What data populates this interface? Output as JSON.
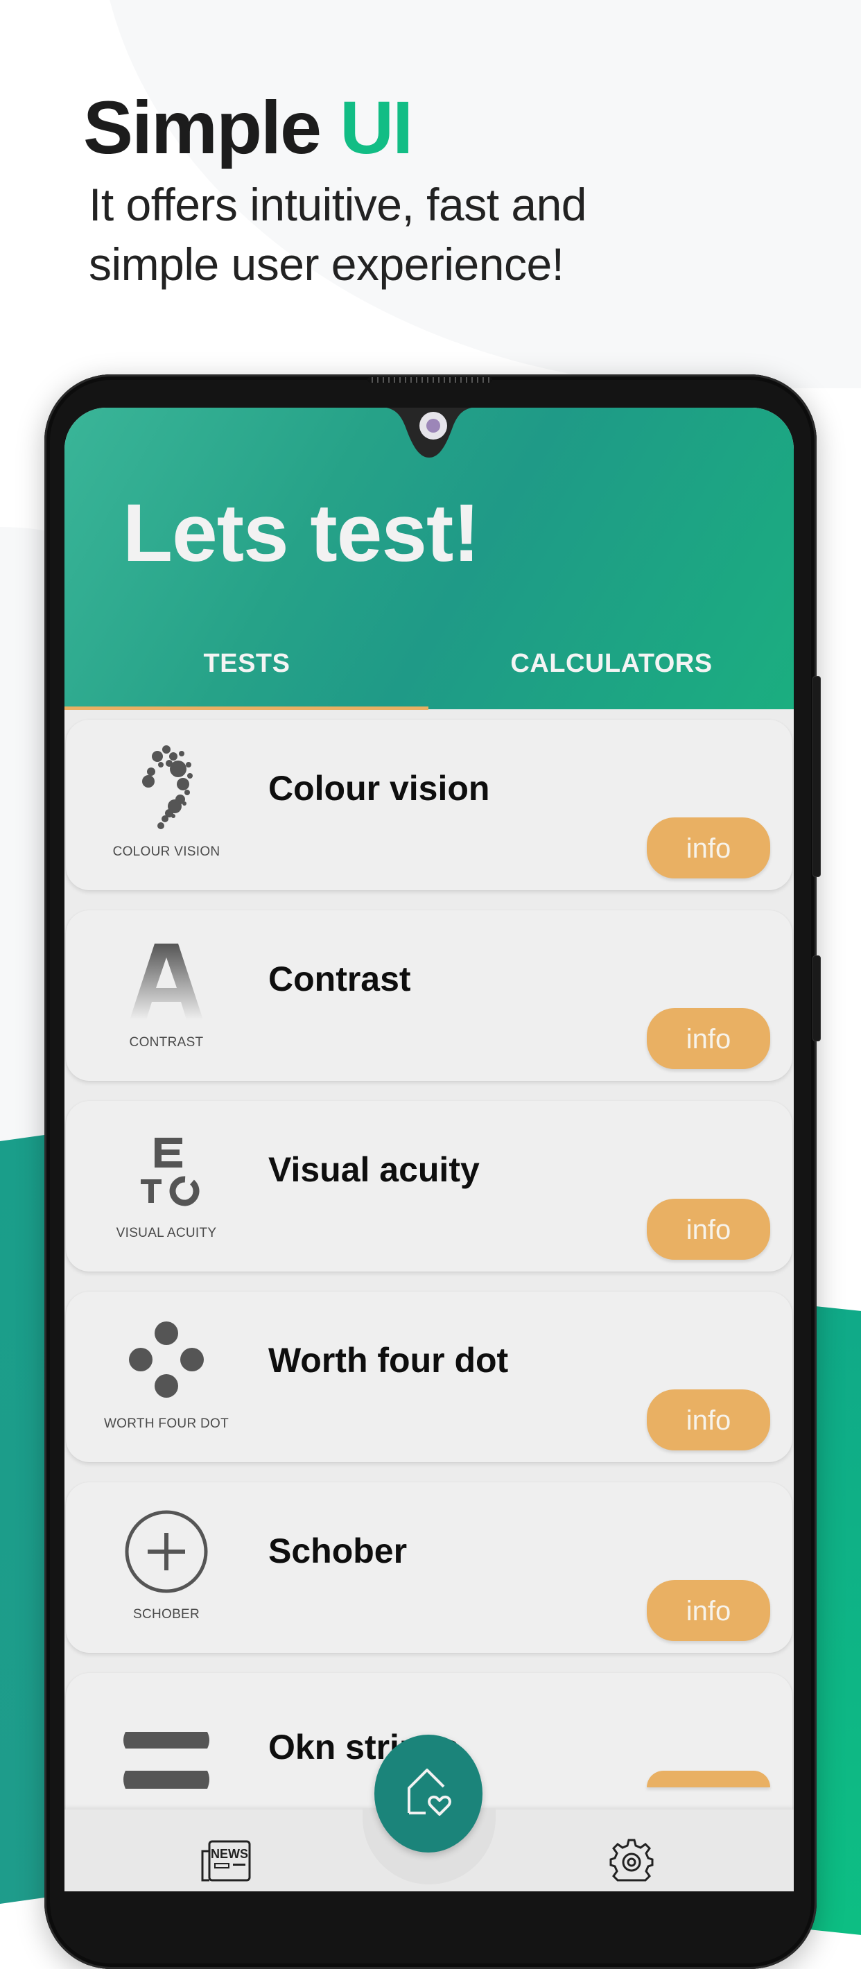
{
  "promo": {
    "title_main": "Simple",
    "title_accent": "UI",
    "subtitle_line1": "It offers intuitive, fast and",
    "subtitle_line2": "simple user experience!"
  },
  "colors": {
    "accent_green": "#12bd85",
    "header_teal": "#26a288",
    "info_orange": "#e9b063",
    "fab_teal": "#1b847a"
  },
  "app": {
    "header_title": "Lets test!",
    "tabs": [
      {
        "label": "TESTS",
        "active": true
      },
      {
        "label": "CALCULATORS",
        "active": false
      }
    ],
    "tests": [
      {
        "title": "Colour vision",
        "icon_label": "COLOUR VISION",
        "icon": "dotted-question-mark-icon",
        "button": "info"
      },
      {
        "title": "Contrast",
        "icon_label": "CONTRAST",
        "icon": "contrast-letter-a-icon",
        "button": "info"
      },
      {
        "title": "Visual acuity",
        "icon_label": "VISUAL ACUITY",
        "icon": "eye-chart-icon",
        "button": "info"
      },
      {
        "title": "Worth four dot",
        "icon_label": "WORTH FOUR DOT",
        "icon": "four-dots-icon",
        "button": "info"
      },
      {
        "title": "Schober",
        "icon_label": "SCHOBER",
        "icon": "circle-plus-icon",
        "button": "info"
      },
      {
        "title": "Okn stripes",
        "icon_label": "",
        "icon": "stripes-icon",
        "button": "info"
      }
    ],
    "bottom_nav": {
      "news_label": "NEWS",
      "home_icon": "home-heart-icon",
      "settings_icon": "gear-icon"
    }
  }
}
